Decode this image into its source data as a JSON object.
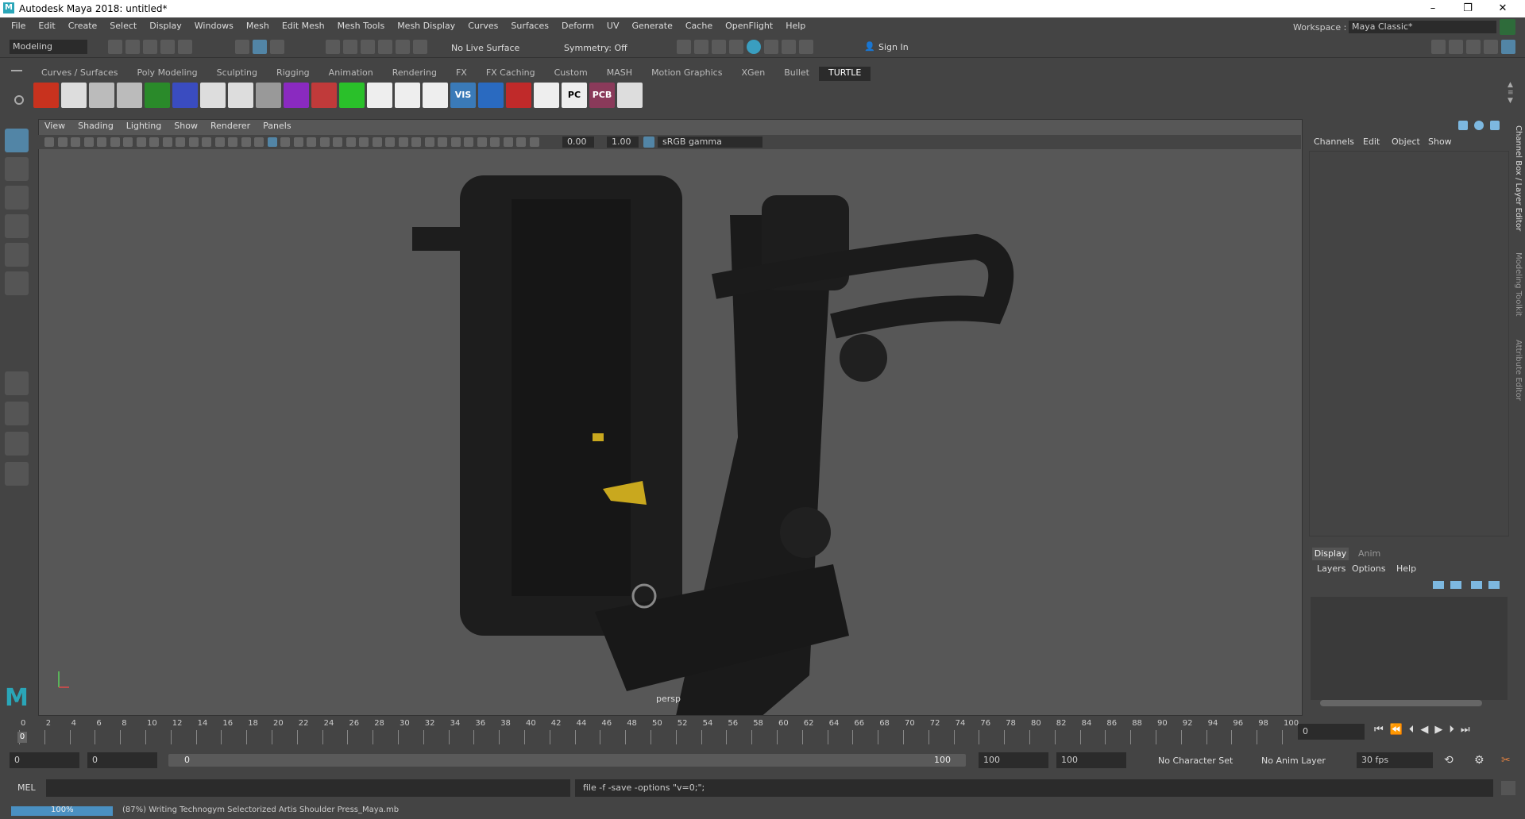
{
  "window": {
    "title": "Autodesk Maya 2018: untitled*",
    "logo": "M"
  },
  "menubar": {
    "items": [
      "File",
      "Edit",
      "Create",
      "Select",
      "Display",
      "Windows",
      "Mesh",
      "Edit Mesh",
      "Mesh Tools",
      "Mesh Display",
      "Curves",
      "Surfaces",
      "Deform",
      "UV",
      "Generate",
      "Cache",
      "OpenFlight",
      "Help"
    ],
    "workspace_label": "Workspace :",
    "workspace_value": "Maya Classic*"
  },
  "statusline": {
    "menuset": "Modeling",
    "live_surface": "No Live Surface",
    "symmetry": "Symmetry: Off",
    "sign_in": "Sign In"
  },
  "shelf": {
    "tabs": [
      "Curves / Surfaces",
      "Poly Modeling",
      "Sculpting",
      "Rigging",
      "Animation",
      "Rendering",
      "FX",
      "FX Caching",
      "Custom",
      "MASH",
      "Motion Graphics",
      "XGen",
      "Bullet",
      "TURTLE"
    ],
    "active_tab": "TURTLE",
    "icon_texts": [
      "VIS",
      "PC",
      "PCB"
    ]
  },
  "viewport": {
    "menus": [
      "View",
      "Shading",
      "Lighting",
      "Show",
      "Renderer",
      "Panels"
    ],
    "exposure": "0.00",
    "gamma": "1.00",
    "color_space": "sRGB gamma",
    "camera_label": "persp"
  },
  "channelbox": {
    "tabs": [
      "Channels",
      "Edit",
      "Object",
      "Show"
    ],
    "layer_tabs": [
      "Display",
      "Anim"
    ],
    "layer_menus": [
      "Layers",
      "Options",
      "Help"
    ],
    "side_tabs": [
      "Channel Box / Layer Editor",
      "Modeling Toolkit",
      "Attribute Editor"
    ]
  },
  "timeline": {
    "ticks": [
      "0",
      "2",
      "4",
      "6",
      "8",
      "10",
      "12",
      "14",
      "16",
      "18",
      "20",
      "22",
      "24",
      "26",
      "28",
      "30",
      "32",
      "34",
      "36",
      "38",
      "40",
      "42",
      "44",
      "46",
      "48",
      "50",
      "52",
      "54",
      "56",
      "58",
      "60",
      "62",
      "64",
      "66",
      "68",
      "70",
      "72",
      "74",
      "76",
      "78",
      "80",
      "82",
      "84",
      "86",
      "88",
      "90",
      "92",
      "94",
      "96",
      "98",
      "100"
    ],
    "current_frame": "0",
    "playhead": "0"
  },
  "range": {
    "start": "0",
    "anim_start": "0",
    "slider_start": "0",
    "slider_end": "100",
    "anim_end": "100",
    "end": "100",
    "character_set": "No Character Set",
    "anim_layer": "No Anim Layer",
    "fps": "30 fps"
  },
  "cmdline": {
    "label": "MEL",
    "output": "file -f -save  -options \"v=0;\";"
  },
  "helpline": {
    "progress_label": "100%",
    "progress_value": 100,
    "message": "(87%) Writing Technogym Selectorized Artis Shoulder Press_Maya.mb"
  }
}
